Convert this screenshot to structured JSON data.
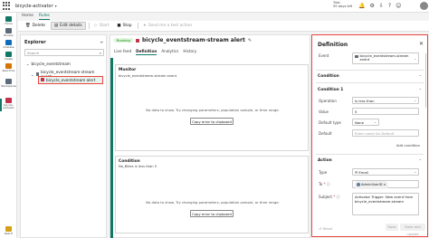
{
  "app": {
    "title": "bicycle-activator",
    "trial_label": "Trial:",
    "trial_days": "59 days left"
  },
  "rail": [
    {
      "label": "Home",
      "color": "#117865"
    },
    {
      "label": "Browse",
      "color": "#5b6b7a"
    },
    {
      "label": "OneLake",
      "color": "#0f6cbd"
    },
    {
      "label": "Create",
      "color": "#117865"
    },
    {
      "label": "Real-Time",
      "color": "#d47500"
    },
    {
      "label": "Workspaces",
      "color": "#5b6b7a"
    },
    {
      "label": "bicycle-activator",
      "color": "#c4314b"
    },
    {
      "label": "Real-Ti",
      "color": "#d4a017"
    }
  ],
  "ribbon": {
    "tabs": [
      "Home",
      "Rules"
    ],
    "selected_tab": "Rules",
    "buttons": {
      "delete": "Delete",
      "edit": "Edit details",
      "start": "Start",
      "stop": "Stop",
      "send": "Send me a test action"
    }
  },
  "explorer": {
    "title": "Explorer",
    "search_placeholder": "Search",
    "tree": {
      "root": "bicycle_eventstream",
      "child": "bicycle_eventstream-stream event",
      "selected": "bicycle_eventstream alert"
    }
  },
  "center": {
    "status": "Running",
    "title": "bicycle_eventstream-stream alert",
    "tabs": [
      "Live feed",
      "Definition",
      "Analytics",
      "History"
    ],
    "selected_tab": "Definition",
    "monitor": {
      "title": "Monitor",
      "subtitle": "bicycle_eventstream-stream event",
      "message": "No data to show. Try changing parameters, population sample, or time range.",
      "button": "Copy error to clipboard"
    },
    "condition": {
      "title": "Condition",
      "subtitle": "No_Bikes is less than 5",
      "message": "No data to show. Try changing parameters, population sample, or time range.",
      "button": "Copy error to clipboard"
    }
  },
  "definition": {
    "title": "Definition",
    "event_label": "Event",
    "event_value": "bicycle_eventstream-stream event",
    "condition_section": "Condition",
    "condition1_section": "Condition 1",
    "operation_label": "Operation",
    "operation_value": "Is less than",
    "value_label": "Value",
    "value_value": "5",
    "default_type_label": "Default type",
    "default_type_value": "None",
    "default_label": "Default",
    "default_placeholder": "Enter value for Default",
    "add_condition": "Add condition",
    "action_section": "Action",
    "type_label": "Type",
    "type_value": "Email",
    "to_label": "To",
    "to_value": "AdminUserID",
    "subject_label": "Subject",
    "subject_value": "Activator Trigger: New event from bicycle_eventstream-stream",
    "reset_label": "Reset",
    "save_label": "Save",
    "update_label": "Save and update"
  }
}
